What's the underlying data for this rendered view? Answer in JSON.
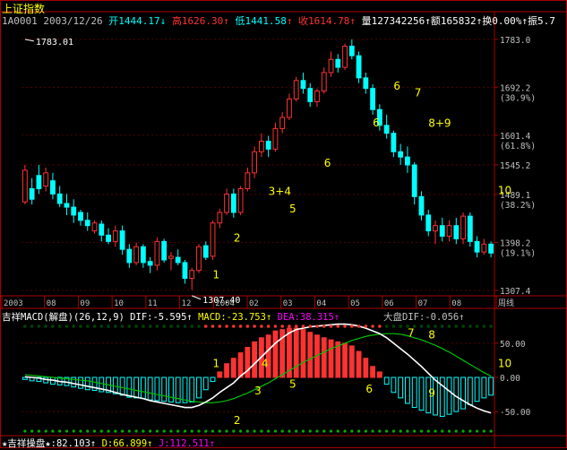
{
  "app": {
    "index_name": "上证指数"
  },
  "header": {
    "code": "1A0001",
    "date": "2003/12/26",
    "open_label": "开",
    "open": "1444.17",
    "high_label": "高",
    "high": "1626.30",
    "low_label": "低",
    "low": "1441.58",
    "close_label": "收",
    "close": "1614.78",
    "volume_label": "量",
    "volume": "127342256",
    "amount_label": "额",
    "amount": "165832",
    "turnover_label": "换",
    "turnover": "0.00%",
    "amplitude_label": "振",
    "amplitude": "5.7"
  },
  "macd_header": {
    "title": "吉祥MACD(解盘)",
    "params": "(26,12,9)",
    "dif_label": "DIF:",
    "dif": "-5.595",
    "macd_label": "MACD:",
    "macd": "-23.753",
    "dea_label": "DEA:",
    "dea": "38.315",
    "market_label": "大盘DIF:",
    "market": "-0.056"
  },
  "footer": {
    "title": "★吉祥操盘★",
    "k_label": ":",
    "k": "82.103",
    "d_label": "D:",
    "d": "66.899",
    "j_label": "J:",
    "j": "112.511"
  },
  "chart_data": [
    {
      "type": "candlestick",
      "title": "上证指数",
      "y_ticks": [
        {
          "value": 1783.0,
          "label": "1783.0",
          "pct": ""
        },
        {
          "value": 1692.2,
          "label": "1692.2",
          "pct": "(30.9%)"
        },
        {
          "value": 1601.4,
          "label": "1601.4",
          "pct": "(61.8%)"
        },
        {
          "value": 1545.2,
          "label": "1545.2",
          "pct": ""
        },
        {
          "value": 1489.1,
          "label": "1489.1",
          "pct": "(38.2%)"
        },
        {
          "value": 1398.2,
          "label": "1398.2",
          "pct": "(19.1%)"
        },
        {
          "value": 1307.4,
          "label": "1307.4",
          "pct": ""
        }
      ],
      "ylim": [
        1297,
        1810
      ],
      "x_labels": [
        "2003",
        "08",
        "09",
        "10",
        "11",
        "12",
        "2004",
        "02",
        "03",
        "04",
        "05",
        "06",
        "07",
        "08",
        "周线"
      ],
      "annotations": [
        {
          "text": "1783.01",
          "value": 1783.01,
          "kind": "high"
        },
        {
          "text": "1307.40",
          "value": 1307.4,
          "kind": "low"
        }
      ],
      "wave_labels": [
        {
          "text": "1",
          "x": 27,
          "y": 1330
        },
        {
          "text": "2",
          "x": 30,
          "y": 1400
        },
        {
          "text": "3+4",
          "x": 35,
          "y": 1488
        },
        {
          "text": "5",
          "x": 38,
          "y": 1455
        },
        {
          "text": "6",
          "x": 43,
          "y": 1542
        },
        {
          "text": "6",
          "x": 50,
          "y": 1618
        },
        {
          "text": "6",
          "x": 53,
          "y": 1688
        },
        {
          "text": "7",
          "x": 56,
          "y": 1675
        },
        {
          "text": "8+9",
          "x": 58,
          "y": 1617
        },
        {
          "text": "10",
          "x": 68,
          "y": 1490
        }
      ],
      "candles": [
        {
          "o": 1475,
          "h": 1545,
          "l": 1470,
          "c": 1535
        },
        {
          "o": 1500,
          "h": 1520,
          "l": 1470,
          "c": 1480
        },
        {
          "o": 1525,
          "h": 1545,
          "l": 1490,
          "c": 1500
        },
        {
          "o": 1505,
          "h": 1540,
          "l": 1495,
          "c": 1530
        },
        {
          "o": 1515,
          "h": 1530,
          "l": 1480,
          "c": 1490
        },
        {
          "o": 1490,
          "h": 1505,
          "l": 1465,
          "c": 1472
        },
        {
          "o": 1472,
          "h": 1490,
          "l": 1450,
          "c": 1465
        },
        {
          "o": 1465,
          "h": 1480,
          "l": 1435,
          "c": 1450
        },
        {
          "o": 1455,
          "h": 1460,
          "l": 1430,
          "c": 1440
        },
        {
          "o": 1440,
          "h": 1455,
          "l": 1420,
          "c": 1430
        },
        {
          "o": 1420,
          "h": 1440,
          "l": 1415,
          "c": 1435
        },
        {
          "o": 1433,
          "h": 1440,
          "l": 1400,
          "c": 1412
        },
        {
          "o": 1412,
          "h": 1425,
          "l": 1395,
          "c": 1400
        },
        {
          "o": 1400,
          "h": 1430,
          "l": 1390,
          "c": 1420
        },
        {
          "o": 1420,
          "h": 1430,
          "l": 1375,
          "c": 1385
        },
        {
          "o": 1385,
          "h": 1395,
          "l": 1350,
          "c": 1360
        },
        {
          "o": 1360,
          "h": 1398,
          "l": 1355,
          "c": 1390
        },
        {
          "o": 1390,
          "h": 1395,
          "l": 1350,
          "c": 1360
        },
        {
          "o": 1362,
          "h": 1370,
          "l": 1340,
          "c": 1355
        },
        {
          "o": 1355,
          "h": 1408,
          "l": 1345,
          "c": 1400
        },
        {
          "o": 1400,
          "h": 1405,
          "l": 1360,
          "c": 1365
        },
        {
          "o": 1368,
          "h": 1380,
          "l": 1345,
          "c": 1372
        },
        {
          "o": 1370,
          "h": 1385,
          "l": 1355,
          "c": 1360
        },
        {
          "o": 1360,
          "h": 1365,
          "l": 1320,
          "c": 1330
        },
        {
          "o": 1330,
          "h": 1350,
          "l": 1308,
          "c": 1345
        },
        {
          "o": 1345,
          "h": 1395,
          "l": 1340,
          "c": 1390
        },
        {
          "o": 1392,
          "h": 1400,
          "l": 1365,
          "c": 1370
        },
        {
          "o": 1372,
          "h": 1440,
          "l": 1365,
          "c": 1435
        },
        {
          "o": 1435,
          "h": 1462,
          "l": 1425,
          "c": 1455
        },
        {
          "o": 1455,
          "h": 1500,
          "l": 1450,
          "c": 1490
        },
        {
          "o": 1490,
          "h": 1500,
          "l": 1445,
          "c": 1455
        },
        {
          "o": 1455,
          "h": 1505,
          "l": 1450,
          "c": 1500
        },
        {
          "o": 1500,
          "h": 1540,
          "l": 1495,
          "c": 1530
        },
        {
          "o": 1530,
          "h": 1580,
          "l": 1520,
          "c": 1570
        },
        {
          "o": 1570,
          "h": 1605,
          "l": 1560,
          "c": 1590
        },
        {
          "o": 1590,
          "h": 1600,
          "l": 1560,
          "c": 1575
        },
        {
          "o": 1575,
          "h": 1625,
          "l": 1570,
          "c": 1614
        },
        {
          "o": 1614,
          "h": 1645,
          "l": 1605,
          "c": 1635
        },
        {
          "o": 1635,
          "h": 1680,
          "l": 1630,
          "c": 1670
        },
        {
          "o": 1670,
          "h": 1712,
          "l": 1665,
          "c": 1705
        },
        {
          "o": 1705,
          "h": 1720,
          "l": 1680,
          "c": 1690
        },
        {
          "o": 1690,
          "h": 1700,
          "l": 1655,
          "c": 1665
        },
        {
          "o": 1665,
          "h": 1690,
          "l": 1655,
          "c": 1685
        },
        {
          "o": 1685,
          "h": 1730,
          "l": 1680,
          "c": 1720
        },
        {
          "o": 1720,
          "h": 1760,
          "l": 1712,
          "c": 1745
        },
        {
          "o": 1745,
          "h": 1755,
          "l": 1720,
          "c": 1730
        },
        {
          "o": 1730,
          "h": 1775,
          "l": 1725,
          "c": 1770
        },
        {
          "o": 1770,
          "h": 1783,
          "l": 1745,
          "c": 1752
        },
        {
          "o": 1752,
          "h": 1760,
          "l": 1700,
          "c": 1710
        },
        {
          "o": 1710,
          "h": 1720,
          "l": 1680,
          "c": 1690
        },
        {
          "o": 1690,
          "h": 1698,
          "l": 1640,
          "c": 1650
        },
        {
          "o": 1650,
          "h": 1660,
          "l": 1610,
          "c": 1620
        },
        {
          "o": 1620,
          "h": 1640,
          "l": 1595,
          "c": 1605
        },
        {
          "o": 1605,
          "h": 1610,
          "l": 1560,
          "c": 1570
        },
        {
          "o": 1570,
          "h": 1585,
          "l": 1545,
          "c": 1560
        },
        {
          "o": 1560,
          "h": 1580,
          "l": 1530,
          "c": 1545
        },
        {
          "o": 1545,
          "h": 1550,
          "l": 1470,
          "c": 1485
        },
        {
          "o": 1485,
          "h": 1495,
          "l": 1440,
          "c": 1450
        },
        {
          "o": 1450,
          "h": 1460,
          "l": 1410,
          "c": 1420
        },
        {
          "o": 1420,
          "h": 1440,
          "l": 1395,
          "c": 1430
        },
        {
          "o": 1430,
          "h": 1445,
          "l": 1400,
          "c": 1410
        },
        {
          "o": 1410,
          "h": 1440,
          "l": 1400,
          "c": 1430
        },
        {
          "o": 1430,
          "h": 1445,
          "l": 1395,
          "c": 1405
        },
        {
          "o": 1405,
          "h": 1455,
          "l": 1395,
          "c": 1448
        },
        {
          "o": 1448,
          "h": 1455,
          "l": 1390,
          "c": 1400
        },
        {
          "o": 1400,
          "h": 1410,
          "l": 1370,
          "c": 1380
        },
        {
          "o": 1380,
          "h": 1405,
          "l": 1375,
          "c": 1395
        },
        {
          "o": 1395,
          "h": 1400,
          "l": 1370,
          "c": 1378
        }
      ]
    },
    {
      "type": "bar",
      "title": "吉祥MACD(解盘)",
      "y_ticks": [
        {
          "value": 50,
          "label": "50.00"
        },
        {
          "value": 0,
          "label": "0.00"
        },
        {
          "value": -50,
          "label": "-50.00"
        }
      ],
      "ylim": [
        -80,
        80
      ],
      "wave_labels": [
        {
          "text": "1",
          "x": 27,
          "y": 15
        },
        {
          "text": "2",
          "x": 30,
          "y": -68
        },
        {
          "text": "3",
          "x": 33,
          "y": -25
        },
        {
          "text": "4",
          "x": 34,
          "y": 15
        },
        {
          "text": "5",
          "x": 38,
          "y": -15
        },
        {
          "text": "6",
          "x": 49,
          "y": -22
        },
        {
          "text": "7",
          "x": 55,
          "y": 60
        },
        {
          "text": "8",
          "x": 58,
          "y": 57
        },
        {
          "text": "9",
          "x": 58,
          "y": -28
        },
        {
          "text": "10",
          "x": 68,
          "y": 15
        }
      ],
      "macd": [
        -3,
        -5,
        -6,
        -8,
        -10,
        -11,
        -12,
        -14,
        -16,
        -18,
        -19,
        -21,
        -22,
        -24,
        -26,
        -29,
        -30,
        -31,
        -33,
        -34,
        -35,
        -36,
        -37,
        -37,
        -36,
        -30,
        -18,
        -6,
        8,
        20,
        28,
        36,
        44,
        52,
        58,
        62,
        68,
        70,
        72,
        72,
        70,
        66,
        62,
        58,
        55,
        52,
        50,
        46,
        38,
        28,
        16,
        8,
        -10,
        -22,
        -30,
        -38,
        -44,
        -48,
        -52,
        -55,
        -57,
        -54,
        -50,
        -46,
        -40,
        -35,
        -30,
        -26
      ],
      "dif": [
        1,
        0,
        -1,
        -3,
        -4,
        -6,
        -7,
        -9,
        -11,
        -13,
        -15,
        -17,
        -19,
        -22,
        -25,
        -27,
        -29,
        -31,
        -34,
        -36,
        -38,
        -40,
        -42,
        -44,
        -44,
        -41,
        -36,
        -30,
        -22,
        -15,
        -8,
        2,
        10,
        20,
        30,
        40,
        50,
        58,
        65,
        70,
        72,
        74,
        75,
        76,
        77,
        78,
        78,
        77,
        75,
        72,
        68,
        64,
        58,
        50,
        42,
        34,
        25,
        16,
        6,
        -4,
        -12,
        -20,
        -28,
        -34,
        -40,
        -45,
        -49,
        -52
      ],
      "dea": [
        4,
        3,
        2,
        1,
        0,
        -1,
        -2,
        -3,
        -4,
        -5,
        -7,
        -9,
        -11,
        -13,
        -15,
        -17,
        -19,
        -21,
        -23,
        -25,
        -27,
        -29,
        -31,
        -33,
        -35,
        -36,
        -37,
        -37,
        -36,
        -34,
        -31,
        -27,
        -23,
        -18,
        -13,
        -8,
        -2,
        4,
        10,
        16,
        22,
        27,
        32,
        37,
        42,
        46,
        50,
        54,
        57,
        60,
        62,
        63,
        64,
        64,
        63,
        61,
        58,
        55,
        51,
        47,
        42,
        37,
        31,
        25,
        19,
        13,
        7,
        2
      ]
    }
  ],
  "colors": {
    "up": "#ff3232",
    "down": "#00ffff",
    "frame": "#a80000",
    "axis_text": "#c0c0c0",
    "label": "#ffff00",
    "dif_line": "#ffffff",
    "dea_line": "#00c000"
  }
}
